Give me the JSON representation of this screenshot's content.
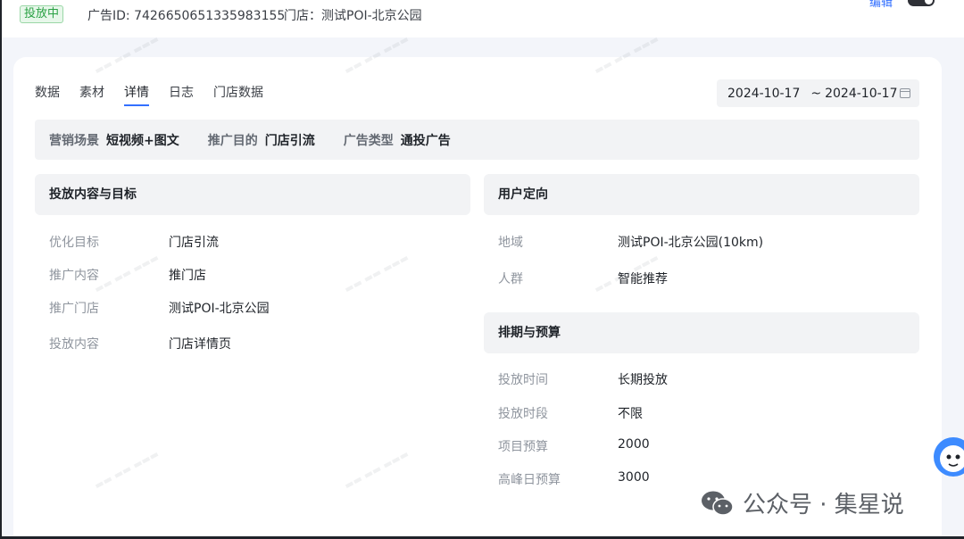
{
  "header": {
    "status": "投放中",
    "ad_id": "广告ID: 7426650651335983155",
    "store": "门店：测试POI-北京公园",
    "edit": "编辑"
  },
  "tabs": [
    {
      "label": "数据"
    },
    {
      "label": "素材"
    },
    {
      "label": "详情",
      "active": true
    },
    {
      "label": "日志"
    },
    {
      "label": "门店数据"
    }
  ],
  "date_range": {
    "start": "2024-10-17",
    "separator": "~",
    "end": "2024-10-17"
  },
  "summary": [
    {
      "key": "营销场景",
      "value": "短视频+图文"
    },
    {
      "key": "推广目的",
      "value": "门店引流"
    },
    {
      "key": "广告类型",
      "value": "通投广告"
    }
  ],
  "content_section": {
    "title": "投放内容与目标",
    "rows": [
      {
        "label": "优化目标",
        "value": "门店引流"
      },
      {
        "label": "推广内容",
        "value": "推门店"
      },
      {
        "label": "推广门店",
        "value": "测试POI-北京公园"
      },
      {
        "label": "投放内容",
        "value": "门店详情页"
      }
    ]
  },
  "targeting_section": {
    "title": "用户定向",
    "rows": [
      {
        "label": "地域",
        "value": "测试POI-北京公园(10km)"
      },
      {
        "label": "人群",
        "value": "智能推荐"
      }
    ]
  },
  "schedule_section": {
    "title": "排期与预算",
    "rows": [
      {
        "label": "投放时间",
        "value": "长期投放"
      },
      {
        "label": "投放时段",
        "value": "不限"
      },
      {
        "label": "项目预算",
        "value": "2000"
      },
      {
        "label": "高峰日预算",
        "value": "3000"
      }
    ]
  },
  "brand": {
    "text": "公众号 · 集星说"
  },
  "colors": {
    "accent": "#3370ff",
    "status_green": "#2aa144",
    "panel_bg": "#f2f3f5"
  }
}
